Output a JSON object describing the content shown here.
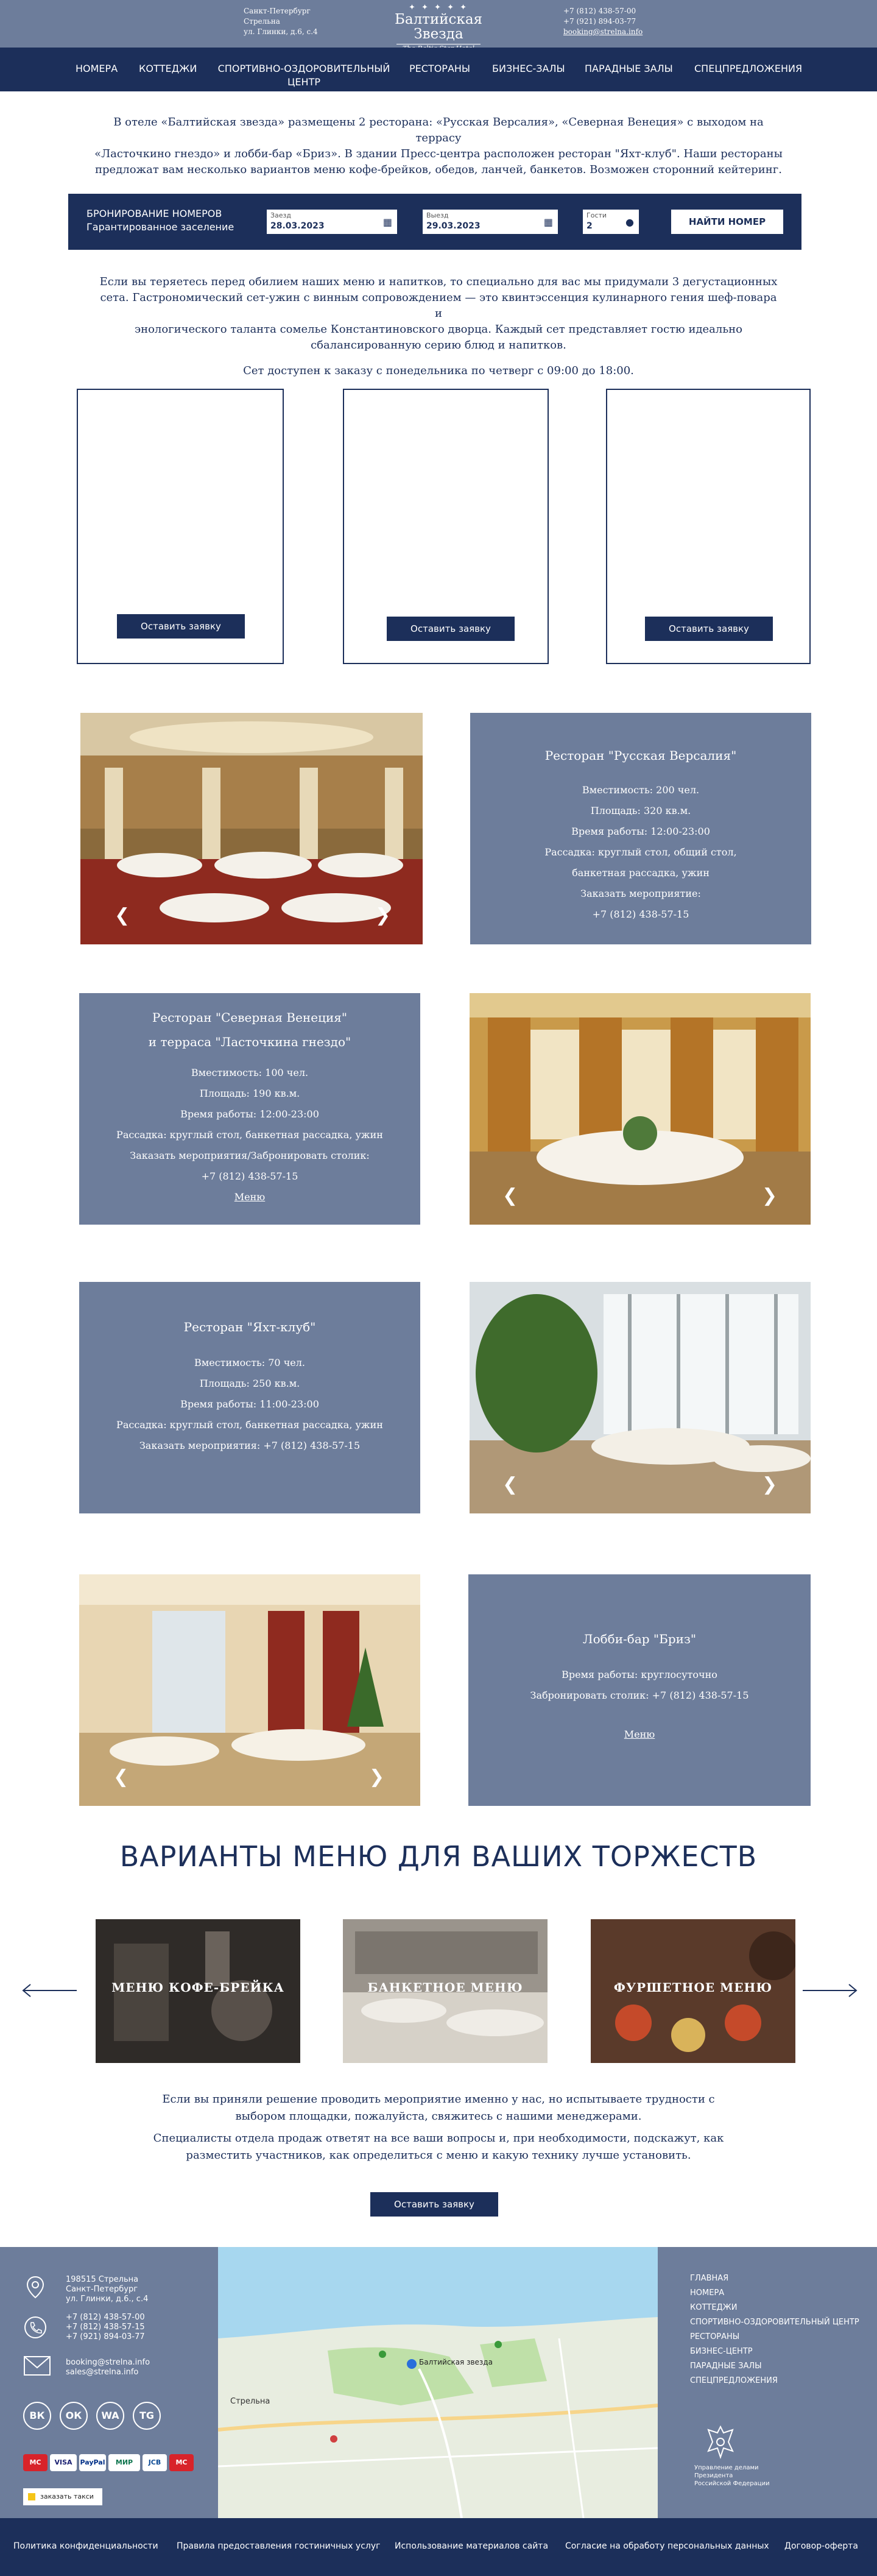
{
  "header": {
    "address_lines": [
      "Санкт-Петербург",
      "Стрельна",
      "ул. Глинки, д.6, с.4"
    ],
    "logo_name": "Балтийская Звезда",
    "logo_sub": "The Baltic Star Hotel",
    "phones": [
      "+7 (812) 438-57-00",
      "+7 (921) 894-03-77"
    ],
    "email": "booking@strelna.info"
  },
  "nav": {
    "items": [
      "НОМЕРА",
      "КОТТЕДЖИ",
      "СПОРТИВНО-ОЗДОРОВИТЕЛЬНЫЙ ЦЕНТР",
      "РЕСТОРАНЫ",
      "БИЗНЕС-ЗАЛЫ",
      "ПАРАДНЫЕ ЗАЛЫ",
      "СПЕЦПРЕДЛОЖЕНИЯ"
    ]
  },
  "intro": {
    "lines": [
      "В отеле «Балтийская звезда» размещены 2 ресторана: «Русская Версалия», «Северная Венеция» с выходом на террасу",
      "«Ласточкино гнездо» и лобби-бар «Бриз». В здании Пресс-центра расположен ресторан \"Яхт-клуб\". Наши рестораны",
      "предложат вам несколько вариантов меню кофе-брейков, обедов, ланчей, банкетов. Возможен сторонний кейтеринг."
    ]
  },
  "booking": {
    "title": "БРОНИРОВАНИЕ НОМЕРОВ",
    "subtitle": "Гарантированное заселение",
    "checkin_label": "Заезд",
    "checkin_value": "28.03.2023",
    "checkout_label": "Выезд",
    "checkout_value": "29.03.2023",
    "guests_label": "Гости",
    "guests_value": "2",
    "find_button": "НАЙТИ НОМЕР"
  },
  "degustation": {
    "lines": [
      "Если вы теряетесь перед обилием наших меню и напитков, то специально для вас мы придумали 3 дегустационных",
      "сета. Гастрономический сет-ужин с винным сопровождением — это квинтэссенция кулинарного гения шеф-повара и",
      "энологического таланта сомелье Константиновского дворца. Каждый сет представляет гостю идеально",
      "сбалансированную серию блюд и напитков."
    ],
    "availability": "Сет доступен к заказу с понедельника по четверг с 09:00 до 18:00.",
    "request_button": "Оставить заявку"
  },
  "restaurants": [
    {
      "title_lines": [
        "Ресторан \"Русская Версалия\""
      ],
      "details": [
        "Вместимость: 200 чел.",
        "Площадь: 320 кв.м.",
        "Время работы: 12:00-23:00",
        "Рассадка: круглый стол, общий стол,",
        "банкетная рассадка, ужин",
        "Заказать мероприятие:",
        "+7 (812) 438-57-15"
      ]
    },
    {
      "title_lines": [
        "Ресторан \"Северная Венеция\"",
        "и терраса \"Ласточкина гнездо\""
      ],
      "details": [
        "Вместимость: 100 чел.",
        "Площадь: 190 кв.м.",
        "Время работы: 12:00-23:00",
        "Рассадка: круглый стол, банкетная рассадка, ужин",
        "Заказать мероприятия/Забронировать столик:",
        "+7 (812) 438-57-15"
      ],
      "link": "Меню"
    },
    {
      "title_lines": [
        "Ресторан \"Яхт-клуб\""
      ],
      "details": [
        "Вместимость: 70 чел.",
        "Площадь: 250 кв.м.",
        "Время работы: 11:00-23:00",
        "Рассадка: круглый стол, банкетная рассадка, ужин",
        "Заказать мероприятия: +7 (812) 438-57-15"
      ]
    },
    {
      "title_lines": [
        "Лобби-бар \"Бриз\""
      ],
      "details": [
        "Время работы: круглосуточно",
        "Забронировать столик: +7 (812) 438-57-15"
      ],
      "link": "Меню"
    }
  ],
  "menus": {
    "heading": "ВАРИАНТЫ МЕНЮ ДЛЯ ВАШИХ ТОРЖЕСТВ",
    "cards": [
      "МЕНЮ КОФЕ-БРЕЙКА",
      "БАНКЕТНОЕ МЕНЮ",
      "ФУРШЕТНОЕ МЕНЮ"
    ],
    "outro_1": "Если вы приняли решение проводить мероприятие именно у нас, но испытываете трудности с выбором площадки, пожалуйста, свяжитесь с нашими менеджерами.",
    "outro_2": "Специалисты отдела продаж ответят на все ваши вопросы и, при необходимости, подскажут, как разместить участников, как определиться с меню и какую технику лучше установить.",
    "request_button": "Оставить заявку"
  },
  "footer": {
    "address": [
      "198515 Стрельна",
      "Санкт-Петербург",
      "ул. Глинки, д.6., с.4"
    ],
    "phones": [
      "+7 (812) 438-57-00",
      "+7 (812) 438-57-15",
      "+7 (921) 894-03-77"
    ],
    "emails": [
      "booking@strelna.info",
      "sales@strelna.info"
    ],
    "social": [
      "ВК",
      "ОК",
      "WA",
      "TG"
    ],
    "payments": [
      "MC",
      "VISA",
      "PayPal",
      "МИР",
      "JCB",
      "MC"
    ],
    "taxi": "заказать такси",
    "map_labels": [
      "Балтийская звезда",
      "Стрельна"
    ],
    "nav": [
      "ГЛАВНАЯ",
      "НОМЕРА",
      "КОТТЕДЖИ",
      "СПОРТИВНО-ОЗДОРОВИТЕЛЬНЫЙ ЦЕНТР",
      "РЕСТОРАНЫ",
      "БИЗНЕС-ЦЕНТР",
      "ПАРАДНЫЕ ЗАЛЫ",
      "СПЕЦПРЕДЛОЖЕНИЯ"
    ],
    "emblem_caption": [
      "Управление делами",
      "Президента",
      "Российской Федерации"
    ]
  },
  "bottom_links": [
    "Политика конфиденциальности",
    "Правила предоставления гостиничных услуг",
    "Использование материалов сайта",
    "Согласие на обработу персональных данных",
    "Договор-оферта"
  ],
  "colors": {
    "navy": "#1c2f5a",
    "slate": "#6d7d9b"
  }
}
